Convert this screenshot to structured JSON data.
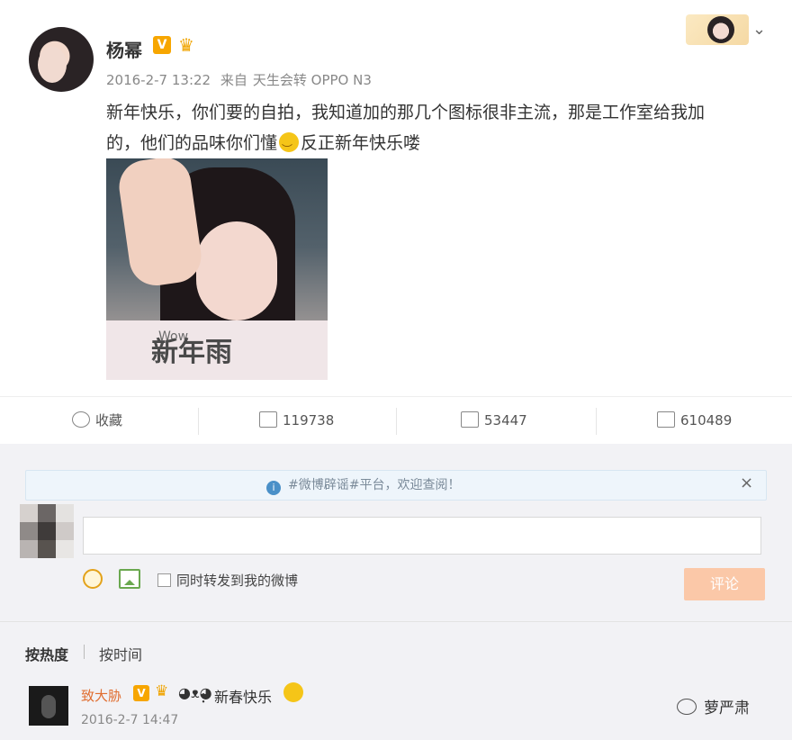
{
  "post": {
    "username": "杨幂",
    "v_badge": "V",
    "time": "2016-2-7 13:22",
    "source_prefix": "来自",
    "source": "天生会转 OPPO N3",
    "text_line1": "新年快乐，你们要的自拍，我知道加的那几个图标很非主流，那是工作室给我加",
    "text_line2_a": "的，他们的品味你们懂",
    "text_line2_b": "反正新年快乐喽",
    "photo_sticker": "新年雨",
    "photo_sticker_small": "Wow",
    "chevron": "⌄"
  },
  "actions": {
    "favorite_label": "收藏",
    "repost_count": "119738",
    "comment_count": "53447",
    "like_count": "610489"
  },
  "notice": {
    "info_icon": "i",
    "text": "#微博辟谣#平台，欢迎查阅！",
    "close": "×"
  },
  "composer": {
    "input_value": "",
    "checkbox_label": "同时转发到我的微博",
    "submit_label": "评论"
  },
  "sort": {
    "hot_label": "按热度",
    "time_label": "按时间"
  },
  "comment": {
    "username": "致大胁",
    "v_badge": "V",
    "text": "：新春快乐",
    "date": "2016-2-7 14:47"
  },
  "watermark": {
    "text": "萝严肃"
  }
}
